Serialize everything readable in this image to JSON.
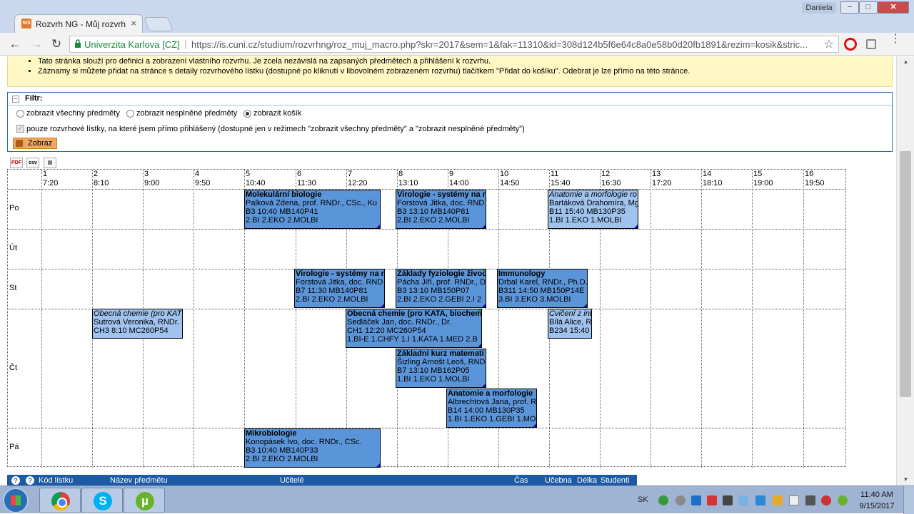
{
  "browser": {
    "tab_favicon": "SIS",
    "tab_title": "Rozvrh NG - Můj rozvrh -",
    "tab_close": "×",
    "user": "Daniela",
    "window_buttons": {
      "minimize": "−",
      "maximize": "□",
      "close": "✕"
    },
    "nav": {
      "back": "←",
      "forward": "→",
      "reload": "↻"
    },
    "site_name": "Univerzita Karlova [CZ]",
    "url": "https://is.cuni.cz/studium/rozvrhng/roz_muj_macro.php?skr=2017&sem=1&fak=11310&id=308d124b5f6e64c8a0e58b0d20fb1891&rezim=kosik&stric...",
    "icons": [
      "lock-icon",
      "star-icon",
      "opera-icon",
      "extension-icon",
      "menu-icon"
    ]
  },
  "info": {
    "items": [
      "Tato stránka slouží pro definici a zobrazení vlastního rozvrhu. Je zcela nezávislá na zapsaných předmětech a přihlášení k rozvrhu.",
      "Záznamy si můžete přidat na stránce s detaily rozvrhového lístku (dostupné po kliknutí v libovolném zobrazeném rozvrhu) tlačítkem \"Přidat do košíku\". Odebrat je lze přímo na této stránce."
    ]
  },
  "filtr": {
    "title": "Filtr:",
    "toggle": "−",
    "radios": [
      {
        "label": "zobrazit všechny předměty",
        "checked": false
      },
      {
        "label": "zobrazit nesplněné předměty",
        "checked": false
      },
      {
        "label": "zobrazit košík",
        "checked": true
      }
    ],
    "checkbox_label": "pouze rozvrhové lístky, na které jsem přímo přihlášený (dostupné jen v režimech \"zobrazit všechny předměty\" a \"zobrazit nesplněné předměty\")",
    "checkbox_mark": "✓",
    "button": "Zobraz"
  },
  "export": {
    "pdf": "PDF",
    "csv": "csv",
    "print": "▤"
  },
  "timetable": {
    "columns": [
      {
        "n": "1",
        "t": "7:20"
      },
      {
        "n": "2",
        "t": "8:10"
      },
      {
        "n": "3",
        "t": "9:00"
      },
      {
        "n": "4",
        "t": "9:50"
      },
      {
        "n": "5",
        "t": "10:40"
      },
      {
        "n": "6",
        "t": "11:30"
      },
      {
        "n": "7",
        "t": "12:20"
      },
      {
        "n": "8",
        "t": "13:10"
      },
      {
        "n": "9",
        "t": "14:00"
      },
      {
        "n": "10",
        "t": "14:50"
      },
      {
        "n": "11",
        "t": "15:40"
      },
      {
        "n": "12",
        "t": "16:30"
      },
      {
        "n": "13",
        "t": "17:20"
      },
      {
        "n": "14",
        "t": "18:10"
      },
      {
        "n": "15",
        "t": "19:00"
      },
      {
        "n": "16",
        "t": "19:50"
      }
    ],
    "days": [
      "Po",
      "Út",
      "St",
      "Čt",
      "Pá"
    ],
    "events": [
      {
        "day": 0,
        "title": "Molekulární biologie",
        "teacher": "Palková Zdena, prof. RNDr., CSc., Ku",
        "room": "B3 10:40 MB140P41",
        "groups": "2.BI 2.EKO 2.MOLBI",
        "style": "dark"
      },
      {
        "day": 0,
        "title": "Virologie - systémy na r",
        "teacher": "Forstová Jitka, doc. RND",
        "room": "B3 13:10 MB140P81",
        "groups": "2.BI 2.EKO 2.MOLBI",
        "style": "dark"
      },
      {
        "day": 0,
        "title": "Anatomie a morfologie ro",
        "teacher": "Bartáková Drahomíra, Mg",
        "room": "B11 15:40 MB130P35",
        "groups": "1.BI 1.EKO 1.MOLBI",
        "style": "light"
      },
      {
        "day": 2,
        "title": "Virologie - systémy na r",
        "teacher": "Forstová Jitka, doc. RND",
        "room": "B7 11:30 MB140P81",
        "groups": "2.BI 2.EKO 2.MOLBI",
        "style": "dark"
      },
      {
        "day": 2,
        "title": "Základy fyziologie živoč",
        "teacher": "Pácha Jiří, prof. RNDr., D",
        "room": "B3 13:10 MB150P07",
        "groups": "2.BI 2.EKO 2.GEBI 2.I 2",
        "style": "dark"
      },
      {
        "day": 2,
        "title": "Immunology",
        "teacher": "Drbal Karel, RNDr., Ph.D.",
        "room": "B311 14:50 MB150P14E",
        "groups": "3.BI 3.EKO 3.MOLBI",
        "style": "dark"
      },
      {
        "day": 3,
        "title": "Obecná chemie (pro KAT",
        "teacher": "Sutrová Veronika, RNDr.",
        "room": "CH3 8:10 MC260P54",
        "groups": "",
        "style": "light"
      },
      {
        "day": 3,
        "title": "Obecná chemie (pro KATA, biochem",
        "teacher": "Sedláček Jan, doc. RNDr., Dr.",
        "room": "CH1 12:20 MC260P54",
        "groups": "1.BI-E 1.CHFY 1.I 1.KATA 1.MED 2.B",
        "style": "dark"
      },
      {
        "day": 3,
        "title": "Cvičení z int",
        "teacher": "Bílá Alice, R",
        "room": "B234 15:40",
        "groups": "",
        "style": "light"
      },
      {
        "day": 3,
        "title": "Základní kurz matemati",
        "teacher": "Šizling Arnošt Leoš, RND",
        "room": "B7 13:10 MB162P05",
        "groups": "1.BI 1.EKO 1.MOLBI",
        "style": "dark"
      },
      {
        "day": 3,
        "title": "Anatomie a morfologie",
        "teacher": "Albrechtová Jana, prof. R",
        "room": "B14 14:00 MB130P35",
        "groups": "1.BI 1.EKO 1.GEBI 1.MO",
        "style": "dark"
      },
      {
        "day": 4,
        "title": "Mikrobiologie",
        "teacher": "Konopásek Ivo, doc. RNDr., CSc.",
        "room": "B3 10:40 MB140P33",
        "groups": "2.BI 2.EKO 2.MOLBI",
        "style": "dark"
      }
    ]
  },
  "list_header": {
    "q1": "?",
    "q2": "?",
    "kod": "Kód lístku",
    "nazev": "Název předmětu",
    "ucitele": "Učitelé",
    "cas": "Čas",
    "ucebna": "Učebna",
    "delka": "Délka",
    "studenti": "Studenti"
  },
  "taskbar": {
    "apps": [
      "chrome-icon",
      "skype-icon",
      "utorrent-icon"
    ],
    "skype_glyph": "S",
    "utorrent_glyph": "µ",
    "lang": "SK",
    "time": "11:40 AM",
    "date": "9/15/2017"
  },
  "colors": {
    "event_dark": "#5b95d9",
    "event_light": "#9fc3ee",
    "info_bg": "#fff8c4",
    "header_blue": "#1c5aa6",
    "button_orange": "#f0a860"
  }
}
